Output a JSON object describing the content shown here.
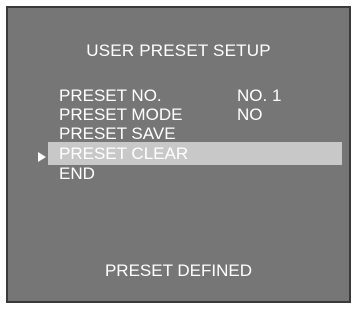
{
  "menu": {
    "title": "USER PRESET SETUP",
    "items": [
      {
        "label": "PRESET NO.",
        "value": "NO.  1"
      },
      {
        "label": "PRESET MODE",
        "value": "NO"
      },
      {
        "label": "PRESET SAVE",
        "value": ""
      },
      {
        "label": "PRESET CLEAR",
        "value": "",
        "selected": true
      },
      {
        "label": "END",
        "value": ""
      }
    ],
    "status": "PRESET DEFINED"
  },
  "colors": {
    "background": "#767676",
    "text": "#ffffff",
    "highlight": "#c8c8c8",
    "border": "#3a3a3a"
  },
  "icons": {
    "cursor": "right-triangle-icon"
  }
}
